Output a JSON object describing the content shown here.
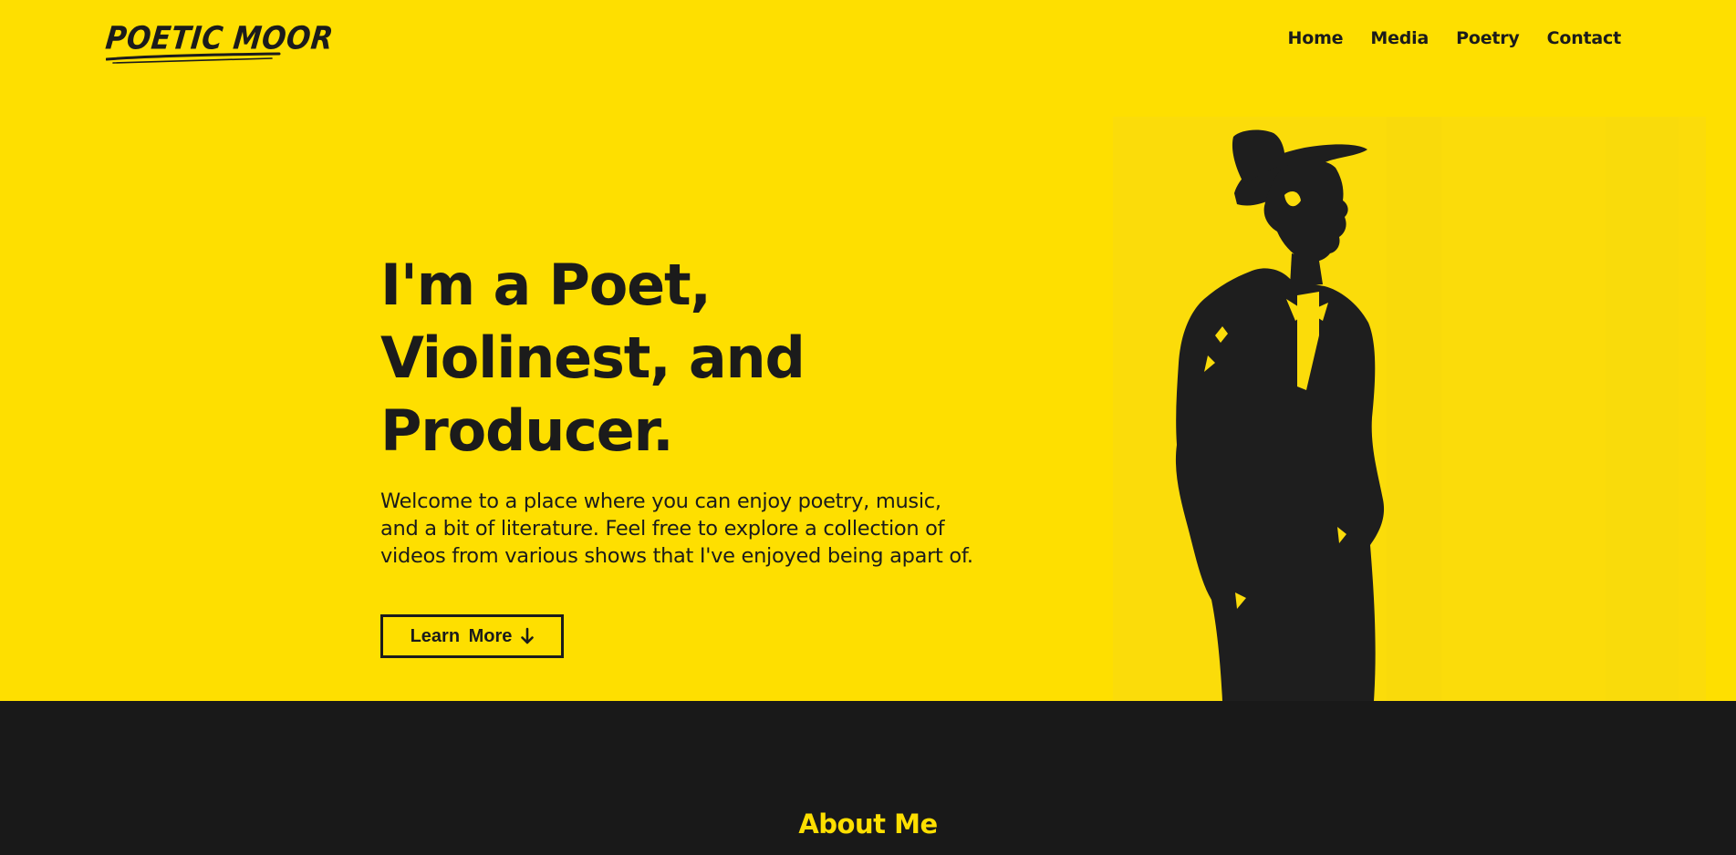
{
  "brand": {
    "logo_text": "POETIC MOOR"
  },
  "nav": {
    "items": [
      {
        "label": "Home"
      },
      {
        "label": "Media"
      },
      {
        "label": "Poetry"
      },
      {
        "label": "Contact"
      }
    ]
  },
  "hero": {
    "heading": "I'm a Poet,\nViolinest, and\nProducer.",
    "body": "Welcome to a place where you can enjoy poetry, music, and a bit of literature. Feel free to explore a collection of videos from various shows that I've enjoyed being apart of.",
    "cta_label": "Learn More",
    "cta_icon": "arrow-down-icon",
    "image": "silhouette-of-man-in-hat-and-suit"
  },
  "about": {
    "title": "About Me"
  },
  "colors": {
    "accent": "#fedf00",
    "dark": "#191919",
    "text": "#1b1b1b"
  }
}
